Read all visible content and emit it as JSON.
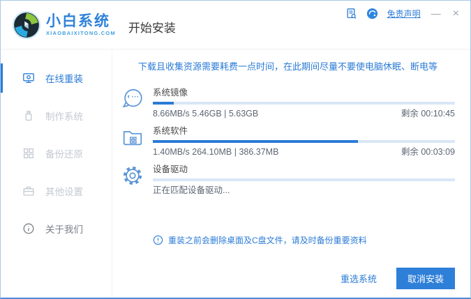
{
  "titlebar": {
    "brand_name": "小白系统",
    "brand_domain": "XIAOBAIXITONG.COM",
    "page_title": "开始安装",
    "disclaimer_link": "免责声明",
    "minimize_glyph": "—",
    "close_glyph": "×"
  },
  "sidebar": {
    "items": [
      {
        "label": "在线重装",
        "icon": "monitor-reinstall-icon",
        "state": "active"
      },
      {
        "label": "制作系统",
        "icon": "usb-drive-icon",
        "state": "disabled"
      },
      {
        "label": "备份还原",
        "icon": "backup-blocks-icon",
        "state": "disabled"
      },
      {
        "label": "其他设置",
        "icon": "toolbox-icon",
        "state": "disabled"
      },
      {
        "label": "关于我们",
        "icon": "info-circle-icon",
        "state": "normal"
      }
    ]
  },
  "main": {
    "notice": "下载且收集资源需要耗费一点时间，在此期间尽量不要使电脑休眠、断电等",
    "tasks": [
      {
        "title": "系统镜像",
        "icon": "chat-face-icon",
        "progress_percent": 7,
        "stats": "8.66MB/s 5.46GB | 5.63GB",
        "remaining": "剩余 00:10:45"
      },
      {
        "title": "系统软件",
        "icon": "software-folder-icon",
        "progress_percent": 68,
        "stats": "1.40MB/s 264.10MB | 386.37MB",
        "remaining": "剩余 00:03:09"
      },
      {
        "title": "设备驱动",
        "icon": "gear-icon",
        "progress_percent": 0,
        "stats": "正在匹配设备驱动...",
        "remaining": ""
      }
    ],
    "warning": "重装之前会删除桌面及C盘文件，请及时备份重要资料"
  },
  "footer": {
    "reselect_label": "重选系统",
    "cancel_label": "取消安装"
  },
  "colors": {
    "accent": "#2b7bd6",
    "progress_track": "#d9e7f6",
    "button_fill": "#2e7fd8",
    "disabled_text": "#c3c9d1"
  }
}
